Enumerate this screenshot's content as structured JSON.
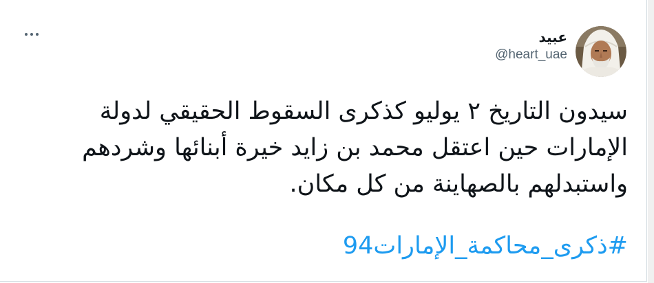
{
  "tweet": {
    "author": {
      "display_name": "عبيد",
      "handle": "@heart_uae",
      "avatar_icon": "profile-photo-icon"
    },
    "more_icon": "more-horizontal-icon",
    "text_lines": [
      "سيدون التاريخ ٢ يوليو كذكرى السقوط الحقيقي لدولة",
      "الإمارات حين اعتقل محمد بن زايد خيرة أبنائها وشردهم",
      "واستبدلهم بالصهاينة من كل مكان."
    ],
    "hashtag": "#ذكرى_محاكمة_الإمارات94"
  },
  "colors": {
    "text": "#0f1419",
    "secondary": "#536471",
    "link": "#1d9bf0",
    "border": "#cfd9de"
  }
}
